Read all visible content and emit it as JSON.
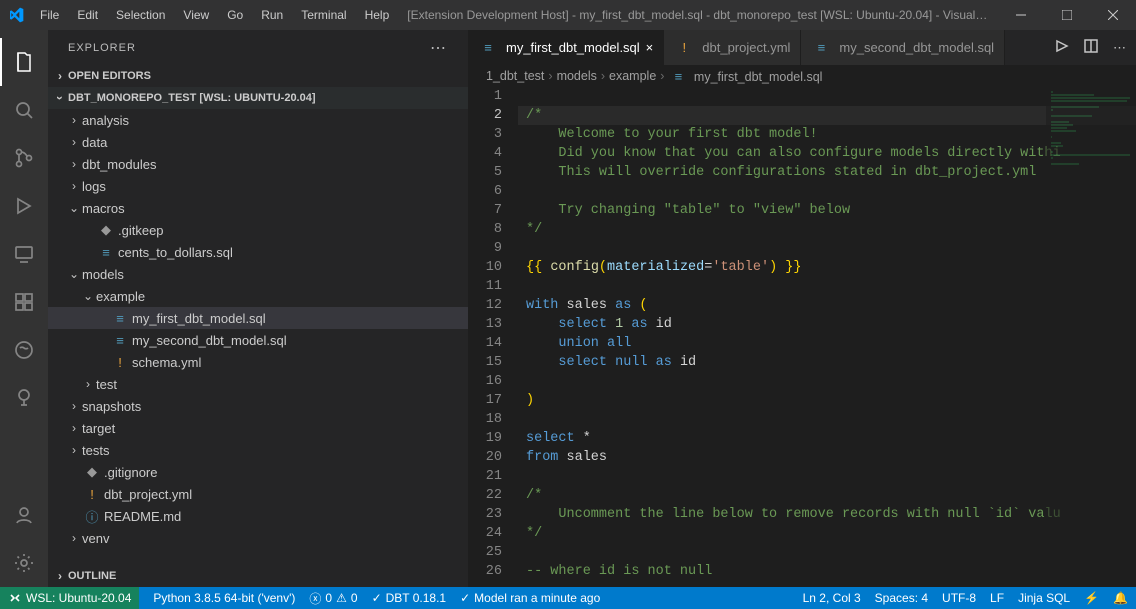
{
  "menubar": [
    "File",
    "Edit",
    "Selection",
    "View",
    "Go",
    "Run",
    "Terminal",
    "Help"
  ],
  "window_title": "[Extension Development Host] - my_first_dbt_model.sql - dbt_monorepo_test [WSL: Ubuntu-20.04] - Visual St...",
  "sidebar": {
    "title": "EXPLORER",
    "sections": {
      "open_editors": "OPEN EDITORS",
      "workspace": "DBT_MONOREPO_TEST [WSL: UBUNTU-20.04]",
      "outline": "OUTLINE"
    }
  },
  "tree": [
    {
      "d": 1,
      "tw": ">",
      "label": "analysis",
      "icon": ""
    },
    {
      "d": 1,
      "tw": ">",
      "label": "data",
      "icon": ""
    },
    {
      "d": 1,
      "tw": ">",
      "label": "dbt_modules",
      "icon": ""
    },
    {
      "d": 1,
      "tw": ">",
      "label": "logs",
      "icon": ""
    },
    {
      "d": 1,
      "tw": "v",
      "label": "macros",
      "icon": ""
    },
    {
      "d": 2,
      "tw": "",
      "label": ".gitkeep",
      "icon": "◆",
      "cls": "git"
    },
    {
      "d": 2,
      "tw": "",
      "label": "cents_to_dollars.sql",
      "icon": "≡",
      "cls": "sql"
    },
    {
      "d": 1,
      "tw": "v",
      "label": "models",
      "icon": ""
    },
    {
      "d": 2,
      "tw": "v",
      "label": "example",
      "icon": ""
    },
    {
      "d": 3,
      "tw": "",
      "label": "my_first_dbt_model.sql",
      "icon": "≡",
      "cls": "sql",
      "selected": true
    },
    {
      "d": 3,
      "tw": "",
      "label": "my_second_dbt_model.sql",
      "icon": "≡",
      "cls": "sql"
    },
    {
      "d": 3,
      "tw": "",
      "label": "schema.yml",
      "icon": "!",
      "cls": "yml"
    },
    {
      "d": 2,
      "tw": ">",
      "label": "test",
      "icon": ""
    },
    {
      "d": 1,
      "tw": ">",
      "label": "snapshots",
      "icon": ""
    },
    {
      "d": 1,
      "tw": ">",
      "label": "target",
      "icon": ""
    },
    {
      "d": 1,
      "tw": ">",
      "label": "tests",
      "icon": ""
    },
    {
      "d": 1,
      "tw": "",
      "label": ".gitignore",
      "icon": "◆",
      "cls": "git"
    },
    {
      "d": 1,
      "tw": "",
      "label": "dbt_project.yml",
      "icon": "!",
      "cls": "yml"
    },
    {
      "d": 1,
      "tw": "",
      "label": "README.md",
      "icon": "ⓘ",
      "cls": "md"
    },
    {
      "d": 1,
      "tw": ">",
      "label": "venv",
      "icon": ""
    }
  ],
  "tabs": [
    {
      "label": "my_first_dbt_model.sql",
      "icon": "≡",
      "iconcls": "sql",
      "active": true,
      "close": "×"
    },
    {
      "label": "dbt_project.yml",
      "icon": "!",
      "iconcls": "yml",
      "active": false,
      "close": ""
    },
    {
      "label": "my_second_dbt_model.sql",
      "icon": "≡",
      "iconcls": "sql",
      "active": false,
      "close": ""
    }
  ],
  "breadcrumbs": [
    "1_dbt_test",
    "models",
    "example",
    "my_first_dbt_model.sql"
  ],
  "code": [
    {
      "n": 1,
      "seg": [
        [
          "",
          "plain"
        ]
      ]
    },
    {
      "n": 2,
      "seg": [
        [
          "/*",
          "comment"
        ]
      ],
      "current": true
    },
    {
      "n": 3,
      "seg": [
        [
          "    Welcome to your first dbt model!",
          "comment"
        ]
      ]
    },
    {
      "n": 4,
      "seg": [
        [
          "    Did you know that you can also configure models directly withi",
          "comment"
        ]
      ]
    },
    {
      "n": 5,
      "seg": [
        [
          "    This will override configurations stated in dbt_project.yml",
          "comment"
        ]
      ]
    },
    {
      "n": 6,
      "seg": [
        [
          "",
          "plain"
        ]
      ]
    },
    {
      "n": 7,
      "seg": [
        [
          "    Try changing \"table\" to \"view\" below",
          "comment"
        ]
      ]
    },
    {
      "n": 8,
      "seg": [
        [
          "*/",
          "comment"
        ]
      ]
    },
    {
      "n": 9,
      "seg": [
        [
          "",
          "plain"
        ]
      ]
    },
    {
      "n": 10,
      "seg": [
        [
          "{{ ",
          "paren"
        ],
        [
          "config",
          "func"
        ],
        [
          "(",
          "paren"
        ],
        [
          "materialized",
          "ident"
        ],
        [
          "=",
          "plain"
        ],
        [
          "'table'",
          "string"
        ],
        [
          ")",
          "paren"
        ],
        [
          " }}",
          "paren"
        ]
      ]
    },
    {
      "n": 11,
      "seg": [
        [
          "",
          "plain"
        ]
      ]
    },
    {
      "n": 12,
      "seg": [
        [
          "with",
          "keyword"
        ],
        [
          " sales ",
          "plain"
        ],
        [
          "as",
          "keyword"
        ],
        [
          " (",
          "paren"
        ]
      ]
    },
    {
      "n": 13,
      "seg": [
        [
          "    ",
          "plain"
        ],
        [
          "select",
          "keyword"
        ],
        [
          " ",
          "plain"
        ],
        [
          "1",
          "num"
        ],
        [
          " ",
          "plain"
        ],
        [
          "as",
          "keyword"
        ],
        [
          " id",
          "plain"
        ]
      ]
    },
    {
      "n": 14,
      "seg": [
        [
          "    ",
          "plain"
        ],
        [
          "union all",
          "keyword"
        ]
      ]
    },
    {
      "n": 15,
      "seg": [
        [
          "    ",
          "plain"
        ],
        [
          "select",
          "keyword"
        ],
        [
          " ",
          "plain"
        ],
        [
          "null",
          "keyword"
        ],
        [
          " ",
          "plain"
        ],
        [
          "as",
          "keyword"
        ],
        [
          " id",
          "plain"
        ]
      ]
    },
    {
      "n": 16,
      "seg": [
        [
          "",
          "plain"
        ]
      ]
    },
    {
      "n": 17,
      "seg": [
        [
          ")",
          "paren"
        ]
      ]
    },
    {
      "n": 18,
      "seg": [
        [
          "",
          "plain"
        ]
      ]
    },
    {
      "n": 19,
      "seg": [
        [
          "select",
          "keyword"
        ],
        [
          " *",
          "plain"
        ]
      ]
    },
    {
      "n": 20,
      "seg": [
        [
          "from",
          "keyword"
        ],
        [
          " sales",
          "plain"
        ]
      ]
    },
    {
      "n": 21,
      "seg": [
        [
          "",
          "plain"
        ]
      ]
    },
    {
      "n": 22,
      "seg": [
        [
          "/*",
          "comment"
        ]
      ]
    },
    {
      "n": 23,
      "seg": [
        [
          "    Uncomment the line below to remove records with null `id` valu",
          "comment"
        ]
      ]
    },
    {
      "n": 24,
      "seg": [
        [
          "*/",
          "comment"
        ]
      ]
    },
    {
      "n": 25,
      "seg": [
        [
          "",
          "plain"
        ]
      ]
    },
    {
      "n": 26,
      "seg": [
        [
          "-- where id is not null",
          "comment"
        ]
      ]
    }
  ],
  "status": {
    "remote": "WSL: Ubuntu-20.04",
    "python": "Python 3.8.5 64-bit ('venv')",
    "problems_errors": "0",
    "problems_warnings": "0",
    "dbt": "DBT 0.18.1",
    "model_run": "Model ran a minute ago",
    "ln_col": "Ln 2, Col 3",
    "spaces": "Spaces: 4",
    "encoding": "UTF-8",
    "eol": "LF",
    "language": "Jinja SQL"
  }
}
